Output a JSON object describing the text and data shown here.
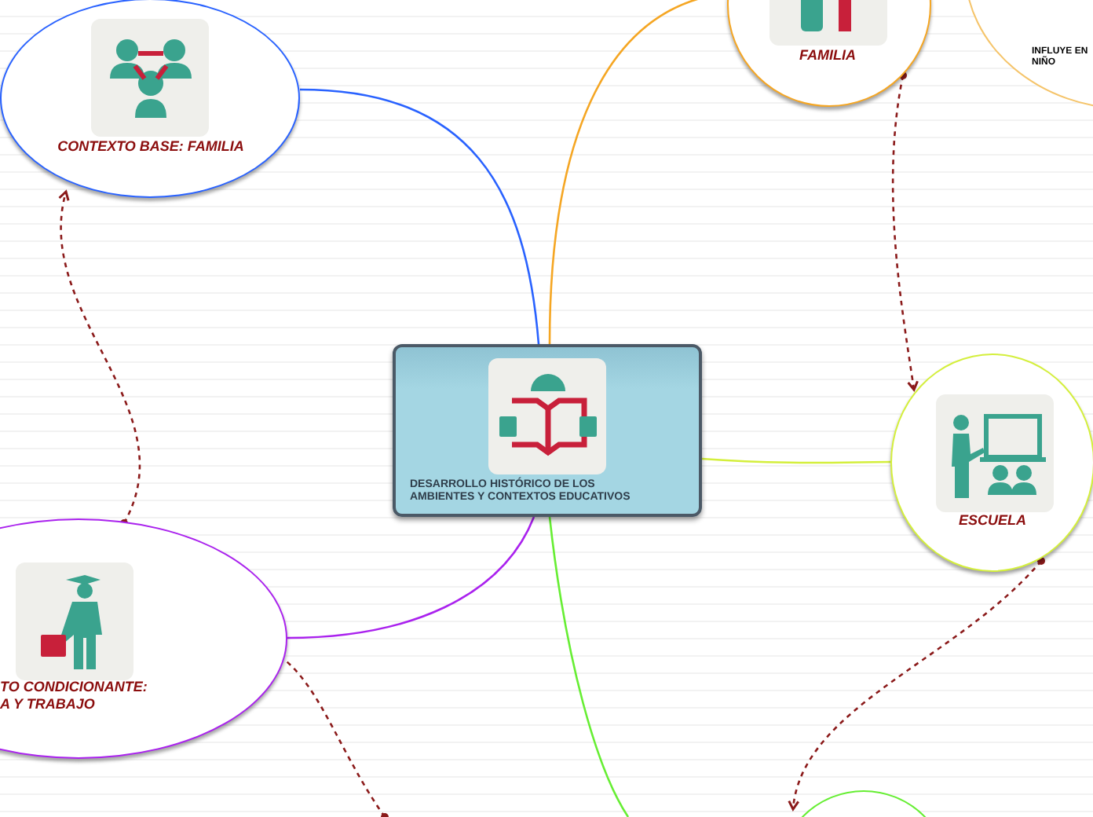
{
  "central_topic": {
    "title_lines": [
      "DESARROLLO HISTÓRICO DE LOS",
      "AMBIENTES Y CONTEXTOS EDUCATIVOS"
    ]
  },
  "nodes": [
    {
      "label_lines": [
        "CONTEXTO BASE: FAMILIA"
      ],
      "color": "#2962ff"
    },
    {
      "label_lines": [
        "FAMILIA"
      ],
      "color": "#f5a623"
    },
    {
      "label_lines": [
        "INFLUYE EN",
        "NIÑO"
      ],
      "color": "#f5c46a"
    },
    {
      "label_lines": [
        "ESCUELA"
      ],
      "color": "#d4ef3c"
    },
    {
      "label_lines": [
        "TO CONDICIONANTE:",
        "A Y TRABAJO"
      ],
      "color": "#aa22ee"
    },
    {
      "color": "#66ee33"
    }
  ]
}
